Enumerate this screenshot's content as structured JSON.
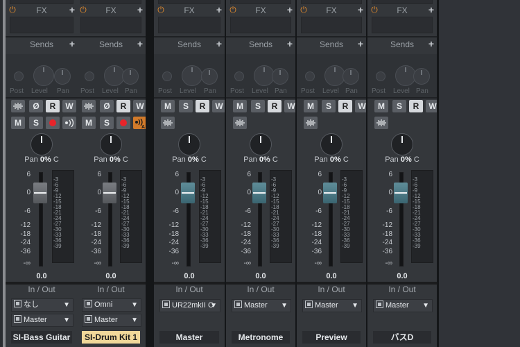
{
  "mixer": {
    "fx_label": "FX",
    "sends_label": "Sends",
    "post_label": "Post",
    "level_label": "Level",
    "pan_small_label": "Pan",
    "pan_label": "Pan",
    "io_label": "In / Out",
    "fader_scale": [
      "6",
      "0",
      "-6",
      "-12",
      "-18",
      "-24",
      "-36",
      "-∞"
    ],
    "meter_scale": [
      "-3",
      "-6",
      "-9",
      "-12",
      "-15",
      "-18",
      "-21",
      "-24",
      "-27",
      "-30",
      "-33",
      "-36",
      "-39"
    ]
  },
  "channels": [
    {
      "name": "SI-Bass Guitar",
      "highlighted": false,
      "type": "instrument",
      "buttons_row1": [
        "phase-invert",
        "Ø",
        "R",
        "W"
      ],
      "buttons_row2": [
        "M",
        "S",
        "record",
        "monitor"
      ],
      "pan_value": "0%",
      "pan_side": "C",
      "fader_value": "0.0",
      "input": "なし",
      "output": "Master",
      "colors": {
        "fader": "#6b6e73"
      }
    },
    {
      "name": "SI-Drum Kit 1",
      "highlighted": true,
      "type": "instrument",
      "buttons_row1": [
        "phase-invert",
        "Ø",
        "R",
        "W"
      ],
      "buttons_row2": [
        "M",
        "S",
        "record",
        "auto-monitor"
      ],
      "pan_value": "0%",
      "pan_side": "C",
      "fader_value": "0.0",
      "input": "Omni",
      "output": "Master",
      "colors": {
        "fader": "#6b6e73"
      }
    },
    {
      "name": "Master",
      "highlighted": false,
      "type": "bus",
      "buttons_row1": [
        "M",
        "S",
        "R",
        "W"
      ],
      "pan_value": "0%",
      "pan_side": "C",
      "fader_value": "0.0",
      "output": "UR22mkII C",
      "colors": {
        "fader": "#4f7f8b"
      }
    },
    {
      "name": "Metronome",
      "highlighted": false,
      "type": "bus",
      "buttons_row1": [
        "M",
        "S",
        "R",
        "W"
      ],
      "pan_value": "0%",
      "pan_side": "C",
      "fader_value": "0.0",
      "output": "Master",
      "colors": {
        "fader": "#4f7f8b"
      }
    },
    {
      "name": "Preview",
      "highlighted": false,
      "type": "bus",
      "buttons_row1": [
        "M",
        "S",
        "R",
        "W"
      ],
      "pan_value": "0%",
      "pan_side": "C",
      "fader_value": "0.0",
      "output": "Master",
      "colors": {
        "fader": "#4f7f8b"
      }
    },
    {
      "name": "バスD",
      "highlighted": false,
      "type": "bus",
      "buttons_row1": [
        "M",
        "S",
        "R",
        "W"
      ],
      "pan_value": "0%",
      "pan_side": "C",
      "fader_value": "0.0",
      "output": "Master",
      "colors": {
        "fader": "#4f7f8b"
      }
    }
  ]
}
